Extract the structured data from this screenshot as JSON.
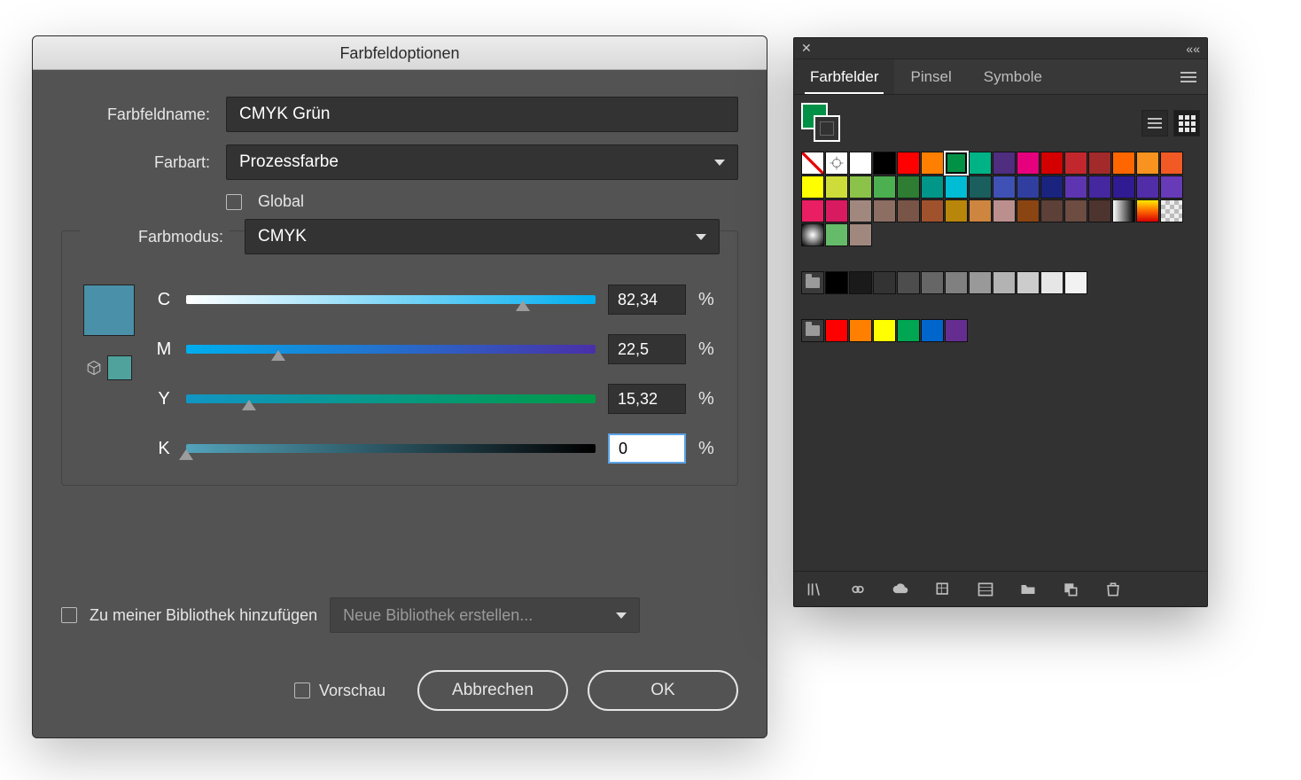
{
  "dialog": {
    "title": "Farbfeldoptionen",
    "name_label": "Farbfeldname:",
    "name_value": "CMYK Grün",
    "type_label": "Farbart:",
    "type_value": "Prozessfarbe",
    "global_label": "Global",
    "mode_label": "Farbmodus:",
    "mode_value": "CMYK",
    "channels": {
      "C": {
        "label": "C",
        "value": "82,34",
        "pct": 82.34
      },
      "M": {
        "label": "M",
        "value": "22,5",
        "pct": 22.5
      },
      "Y": {
        "label": "Y",
        "value": "15,32",
        "pct": 15.32
      },
      "K": {
        "label": "K",
        "value": "0",
        "pct": 0
      }
    },
    "percent_symbol": "%",
    "preview_color": "#4a90a8",
    "orig_color": "#4fa39c",
    "lib_checkbox": "Zu meiner Bibliothek hinzufügen",
    "lib_select": "Neue Bibliothek erstellen...",
    "preview_label": "Vorschau",
    "cancel": "Abbrechen",
    "ok": "OK"
  },
  "panel": {
    "tabs": {
      "swatches": "Farbfelder",
      "brushes": "Pinsel",
      "symbols": "Symbole"
    },
    "fill_color": "#009146",
    "footer_icons": [
      "library",
      "link",
      "cloud",
      "swatch-options",
      "list",
      "folder",
      "new",
      "trash"
    ],
    "rows": [
      [
        {
          "t": "none"
        },
        {
          "t": "reg"
        },
        {
          "c": "#ffffff"
        },
        {
          "c": "#000000"
        },
        {
          "c": "#ff0000"
        },
        {
          "c": "#ff7f00"
        },
        {
          "c": "#009146",
          "sel": true
        },
        {
          "c": "#00b386"
        },
        {
          "c": "#4f2d7f"
        },
        {
          "c": "#e6007e"
        },
        {
          "c": "#d40000"
        },
        {
          "c": "#c1272d"
        },
        {
          "c": "#a22a2a"
        },
        {
          "c": "#ff6600"
        },
        {
          "c": "#f7931e"
        },
        {
          "c": "#f15a24"
        }
      ],
      [
        {
          "c": "#ffff00"
        },
        {
          "c": "#cddc39"
        },
        {
          "c": "#8bc34a"
        },
        {
          "c": "#4caf50"
        },
        {
          "c": "#2e7d32"
        },
        {
          "c": "#009688"
        },
        {
          "c": "#00bcd4"
        },
        {
          "c": "#1b5e5e"
        },
        {
          "c": "#3f51b5"
        },
        {
          "c": "#303f9f"
        },
        {
          "c": "#1a237e"
        },
        {
          "c": "#5e35b1"
        },
        {
          "c": "#4527a0"
        },
        {
          "c": "#311b92"
        },
        {
          "c": "#512da8"
        },
        {
          "c": "#673ab7"
        }
      ],
      [
        {
          "c": "#e91e63"
        },
        {
          "c": "#d81b60"
        },
        {
          "c": "#a1887f"
        },
        {
          "c": "#8d6e63"
        },
        {
          "c": "#795548"
        },
        {
          "c": "#a0522d"
        },
        {
          "c": "#b8860b"
        },
        {
          "c": "#cd853f"
        },
        {
          "c": "#bc8f8f"
        },
        {
          "c": "#8b4513"
        },
        {
          "c": "#5d4037"
        },
        {
          "c": "#6d4c41"
        },
        {
          "c": "#4e342e"
        },
        {
          "c": "#ffffff",
          "grad": "bw"
        },
        {
          "c": "#ffcc00",
          "grad": "yo"
        },
        {
          "c": "#cccccc",
          "grad": "chk"
        }
      ],
      [
        {
          "c": "#888888",
          "grad": "rad"
        },
        {
          "c": "#66bb6a",
          "pat": true
        },
        {
          "c": "#a1887f",
          "pat": true
        }
      ],
      [
        {
          "t": "folder"
        },
        {
          "c": "#000000"
        },
        {
          "c": "#1a1a1a"
        },
        {
          "c": "#333333"
        },
        {
          "c": "#4d4d4d"
        },
        {
          "c": "#666666"
        },
        {
          "c": "#808080"
        },
        {
          "c": "#999999"
        },
        {
          "c": "#b3b3b3"
        },
        {
          "c": "#cccccc"
        },
        {
          "c": "#e6e6e6"
        },
        {
          "c": "#f2f2f2"
        }
      ],
      [
        {
          "t": "folder"
        },
        {
          "c": "#ff0000"
        },
        {
          "c": "#ff8000"
        },
        {
          "c": "#ffff00"
        },
        {
          "c": "#00a651"
        },
        {
          "c": "#0066cc"
        },
        {
          "c": "#662d91"
        }
      ]
    ]
  }
}
